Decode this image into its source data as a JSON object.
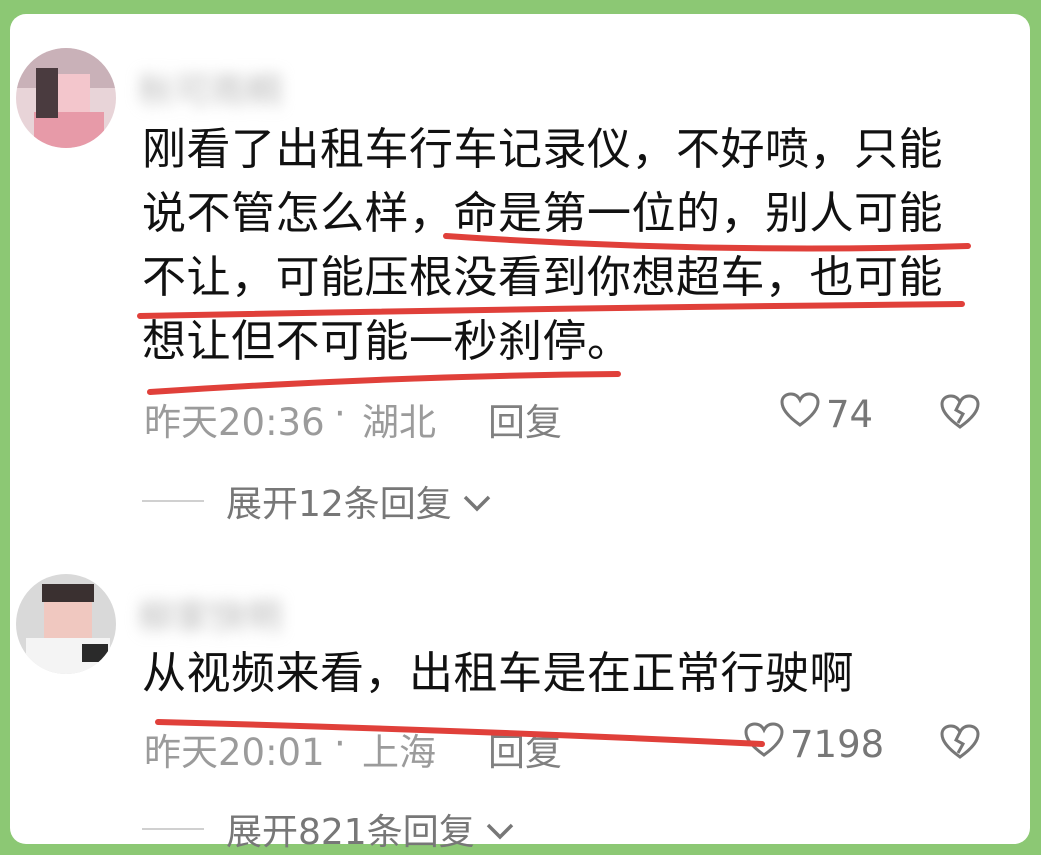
{
  "comments": [
    {
      "username": "秋可雨桐",
      "text": "刚看了出租车行车记录仪，不好喷，只能说不管怎么样，命是第一位的，别人可能不让，可能压根没看到你想超车，也可能想让但不可能一秒刹停。",
      "time": "昨天20:36",
      "separator": "·",
      "location": "湖北",
      "reply_label": "回复",
      "likes": "74",
      "expand_label": "展开12条回复"
    },
    {
      "username": "柳家快明",
      "text": "从视频来看，出租车是在正常行驶啊",
      "time": "昨天20:01",
      "separator": "·",
      "location": "上海",
      "reply_label": "回复",
      "likes": "7198",
      "expand_label": "展开821条回复"
    }
  ],
  "colors": {
    "border": "#8cc874",
    "underline": "#e0403a",
    "meta_text": "#9b9b9b"
  },
  "icons": [
    "heart-outline-icon",
    "broken-heart-icon",
    "chevron-down-icon"
  ]
}
